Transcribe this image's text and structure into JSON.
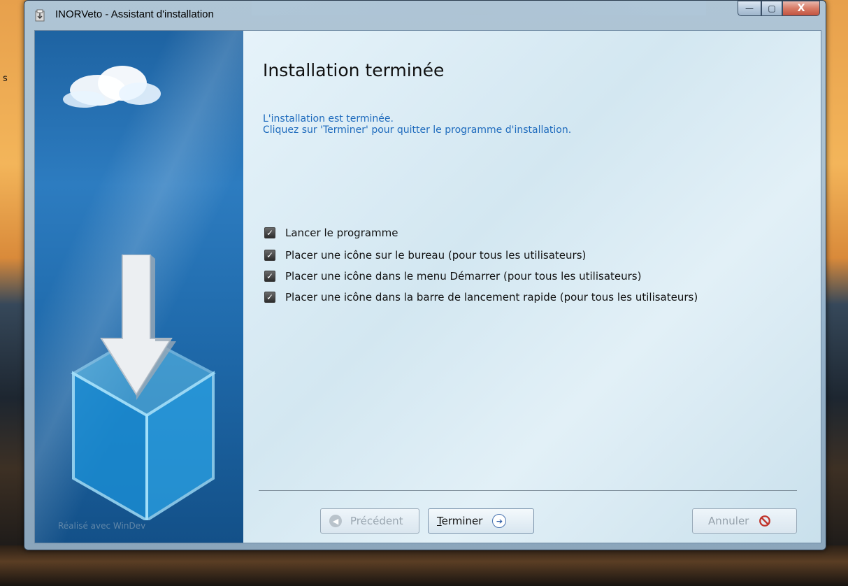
{
  "window": {
    "title": "INORVeto - Assistant d'installation",
    "caption_buttons": {
      "minimize": "—",
      "maximize": "▢",
      "close": "X"
    }
  },
  "left_panel": {
    "footer": "Réalisé avec WinDev"
  },
  "main": {
    "title": "Installation terminée",
    "message_line1": "L'installation est terminée.",
    "message_line2": "Cliquez sur 'Terminer' pour quitter le programme d'installation.",
    "options": [
      {
        "label": "Lancer le programme",
        "checked": true
      },
      {
        "label": "Placer une icône sur le bureau (pour tous les utilisateurs)",
        "checked": true
      },
      {
        "label": "Placer une icône dans le menu Démarrer (pour tous les utilisateurs)",
        "checked": true
      },
      {
        "label": "Placer une icône dans la barre de lancement rapide (pour tous les utilisateurs)",
        "checked": true
      }
    ]
  },
  "buttons": {
    "previous": {
      "label": "Précédent",
      "enabled": false,
      "icon": "arrow-left-icon"
    },
    "finish": {
      "label": "Terminer",
      "enabled": true,
      "icon": "arrow-right-icon"
    },
    "cancel": {
      "label": "Annuler",
      "enabled": false,
      "icon": "no-entry-icon"
    }
  },
  "colors": {
    "message": "#1e6bbd",
    "left_panel": "#1e63a2"
  }
}
